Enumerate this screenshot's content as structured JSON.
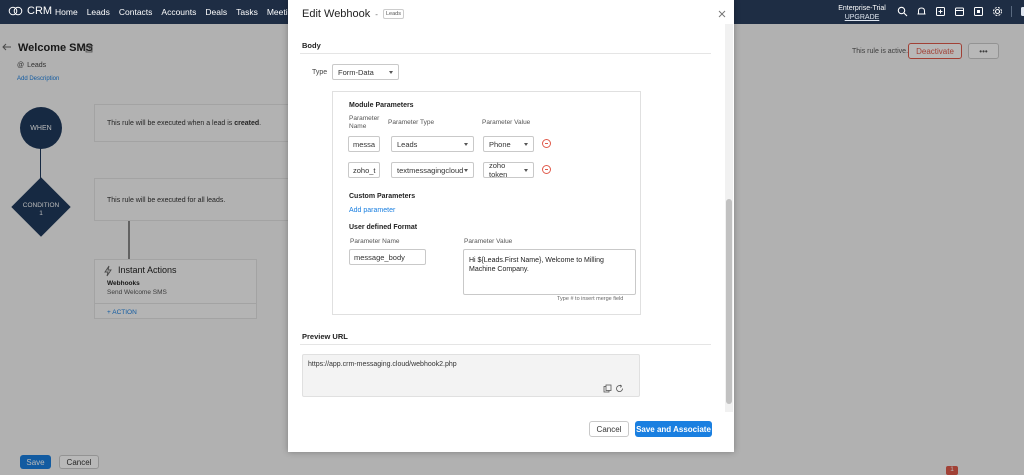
{
  "topbar": {
    "brand": "CRM",
    "nav": [
      "Home",
      "Leads",
      "Contacts",
      "Accounts",
      "Deals",
      "Tasks",
      "Meetings"
    ],
    "plan": "Enterprise-Trial",
    "upgrade": "UPGRADE"
  },
  "rule": {
    "title": "Welcome SMS",
    "module": "Leads",
    "add_description": "Add Description",
    "status_text": "This rule is active.",
    "deactivate_label": "Deactivate",
    "more_label": "•••",
    "when_label": "WHEN",
    "when_text_prefix": "This rule will be executed when a lead is ",
    "when_text_bold": "created",
    "when_text_suffix": ".",
    "condition_label": "CONDITION",
    "condition_number": "1",
    "condition_text": "This rule will be executed for all leads.",
    "instant_actions_title": "Instant Actions",
    "webhooks_label": "Webhooks",
    "webhook_name": "Send Welcome SMS",
    "add_action": "+ ACTION"
  },
  "footer": {
    "save_label": "Save",
    "cancel_label": "Cancel",
    "notification_count": "1"
  },
  "modal": {
    "title": "Edit Webhook",
    "separator": "-",
    "module_badge": "Leads",
    "body_section": "Body",
    "type_label": "Type",
    "type_value": "Form-Data",
    "module_params_title": "Module Parameters",
    "col_param_name": "Parameter Name",
    "col_param_type": "Parameter Type",
    "col_param_value": "Parameter Value",
    "module_params": [
      {
        "name": "messa",
        "type": "Leads",
        "value": "Phone"
      },
      {
        "name": "zoho_t",
        "type": "textmessagingcloud",
        "value": "zoho token"
      }
    ],
    "custom_params_title": "Custom Parameters",
    "add_parameter": "Add parameter",
    "user_format_title": "User defined Format",
    "udf_name_label": "Parameter Name",
    "udf_value_label": "Parameter Value",
    "udf_name_value": "message_body",
    "udf_value_text": "Hi ${Leads.First Name}, Welcome to Milling Machine Company.",
    "merge_hint": "Type # to insert merge field",
    "preview_title": "Preview URL",
    "preview_url": "https://app.crm-messaging.cloud/webhook2.php",
    "cancel_label": "Cancel",
    "save_label": "Save and Associate"
  },
  "colors": {
    "topbar": "#1e2d44",
    "node": "#1f3a5c",
    "primary": "#1a7fe0",
    "danger": "#e05a4b"
  }
}
